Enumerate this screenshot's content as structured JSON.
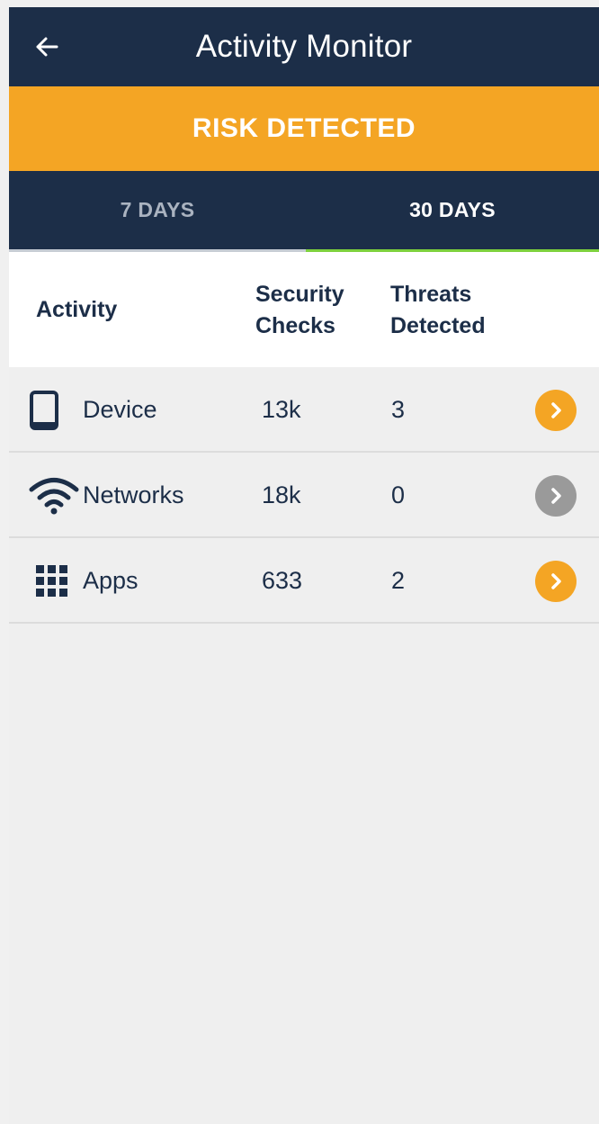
{
  "app_bar": {
    "back_icon": "arrow-left-icon",
    "title": "Activity Monitor"
  },
  "banner": {
    "text": "RISK DETECTED",
    "color": "#f4a524"
  },
  "tabs": [
    {
      "label": "7 DAYS",
      "selected": false
    },
    {
      "label": "30 DAYS",
      "selected": true
    }
  ],
  "colors": {
    "navy": "#1c2e48",
    "accent_orange": "#f4a524",
    "tab_indicator": "#7dd13d",
    "muted_gray": "#9a9a9a"
  },
  "table": {
    "headers": {
      "activity": "Activity",
      "checks_line1": "Security",
      "checks_line2": "Checks",
      "threats_line1": "Threats",
      "threats_line2": "Detected"
    },
    "rows": [
      {
        "icon": "smartphone-icon",
        "label": "Device",
        "security_checks": "13k",
        "threats_detected": "3",
        "chevron": "orange"
      },
      {
        "icon": "wifi-icon",
        "label": "Networks",
        "security_checks": "18k",
        "threats_detected": "0",
        "chevron": "gray"
      },
      {
        "icon": "apps-grid-icon",
        "label": "Apps",
        "security_checks": "633",
        "threats_detected": "2",
        "chevron": "orange"
      }
    ]
  }
}
